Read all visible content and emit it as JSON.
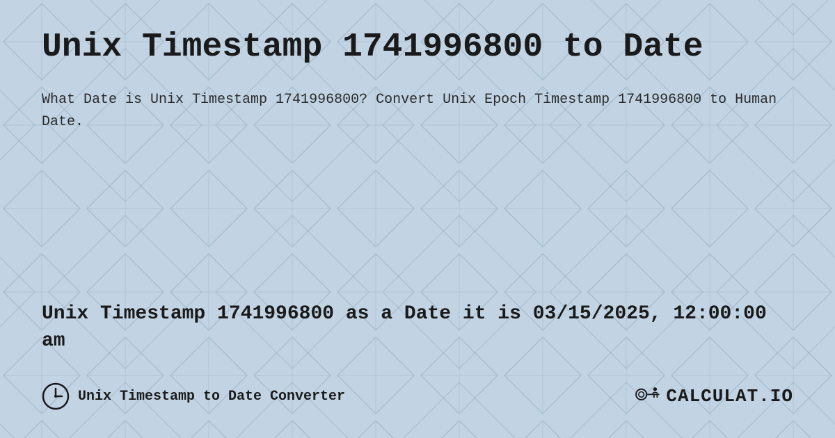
{
  "page": {
    "title": "Unix Timestamp 1741996800 to Date",
    "description": "What Date is Unix Timestamp 1741996800? Convert Unix Epoch Timestamp 1741996800 to Human Date.",
    "result_text": "Unix Timestamp 1741996800 as a Date it is 03/15/2025, 12:00:00 am",
    "footer_label": "Unix Timestamp to Date Converter",
    "logo_text": "CALCULAT.IO",
    "background_color": "#b8cede",
    "accent_color": "#1a1a1a"
  }
}
